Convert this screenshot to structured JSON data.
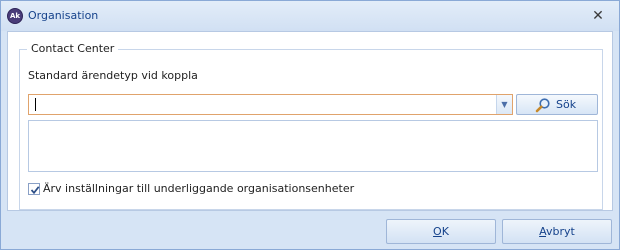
{
  "window": {
    "title": "Organisation",
    "logo_text": "Ak",
    "close_glyph": "✕"
  },
  "group": {
    "legend": "Contact Center",
    "field_label": "Standard ärendetyp vid koppla",
    "combo_value": "",
    "search_button_label": "Sök",
    "memo_value": "",
    "checkbox": {
      "checked": true,
      "label": "Ärv inställningar till underliggande organisationsenheter"
    }
  },
  "footer": {
    "ok_accel": "O",
    "ok_rest": "K",
    "cancel_accel": "A",
    "cancel_rest": "vbryt"
  },
  "colors": {
    "window_bg": "#d6e4f5",
    "accent_text": "#15428b",
    "focus_border": "#e0a36c"
  },
  "icons": [
    "app-logo",
    "close-icon",
    "dropdown-arrow-icon",
    "magnifier-icon",
    "checkmark-icon"
  ]
}
